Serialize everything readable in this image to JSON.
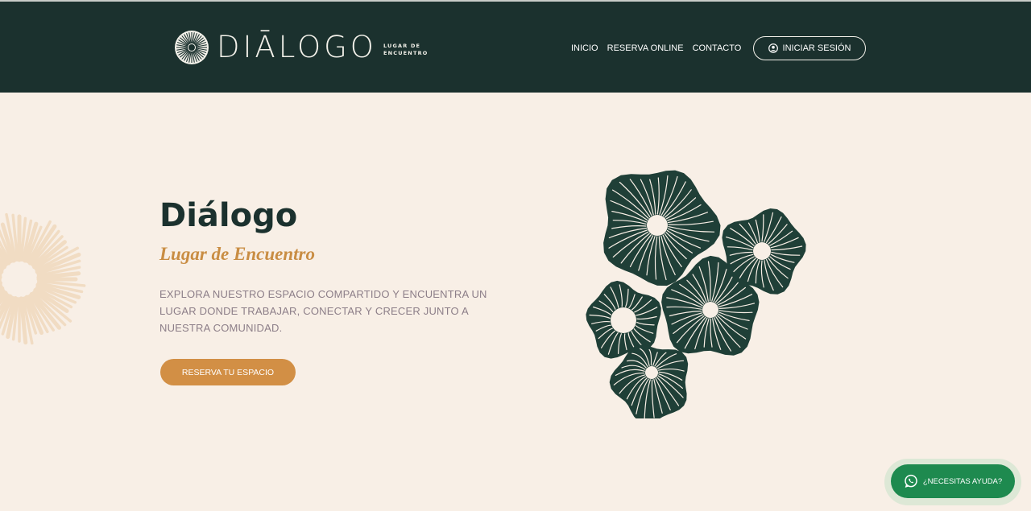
{
  "header": {
    "brand": {
      "name": "DIĀLOGO",
      "tagline_line1": "LUGAR DE",
      "tagline_line2": "ENCUENTRO"
    },
    "nav": [
      {
        "label": "INICIO"
      },
      {
        "label": "RESERVA ONLINE"
      },
      {
        "label": "CONTACTO"
      }
    ],
    "login_label": "INICIAR SESIÓN"
  },
  "hero": {
    "title": "Diálogo",
    "subtitle": "Lugar de Encuentro",
    "description": "EXPLORA NUESTRO ESPACIO COMPARTIDO Y ENCUENTRA UN LUGAR DONDE TRABAJAR, CONECTAR Y CRECER JUNTO A NUESTRA COMUNIDAD.",
    "cta_label": "RESERVA TU ESPACIO"
  },
  "help_widget": {
    "label": "¿NECESITAS AYUDA?"
  },
  "icons": {
    "brand": "mushroom-gill-logo-icon",
    "login": "user-circle-icon",
    "help": "whatsapp-icon",
    "illustration": "mushroom-gills-illustration"
  },
  "colors": {
    "header_bg": "#1b312e",
    "page_bg": "#f8efe6",
    "title": "#1b312e",
    "accent": "#c98d43",
    "cta_bg": "#d28f45",
    "body_text": "#8c7e88",
    "whatsapp": "#1e8a4f",
    "illustration_fill": "#1f3f37",
    "deco_flower": "#f1dcc3"
  }
}
